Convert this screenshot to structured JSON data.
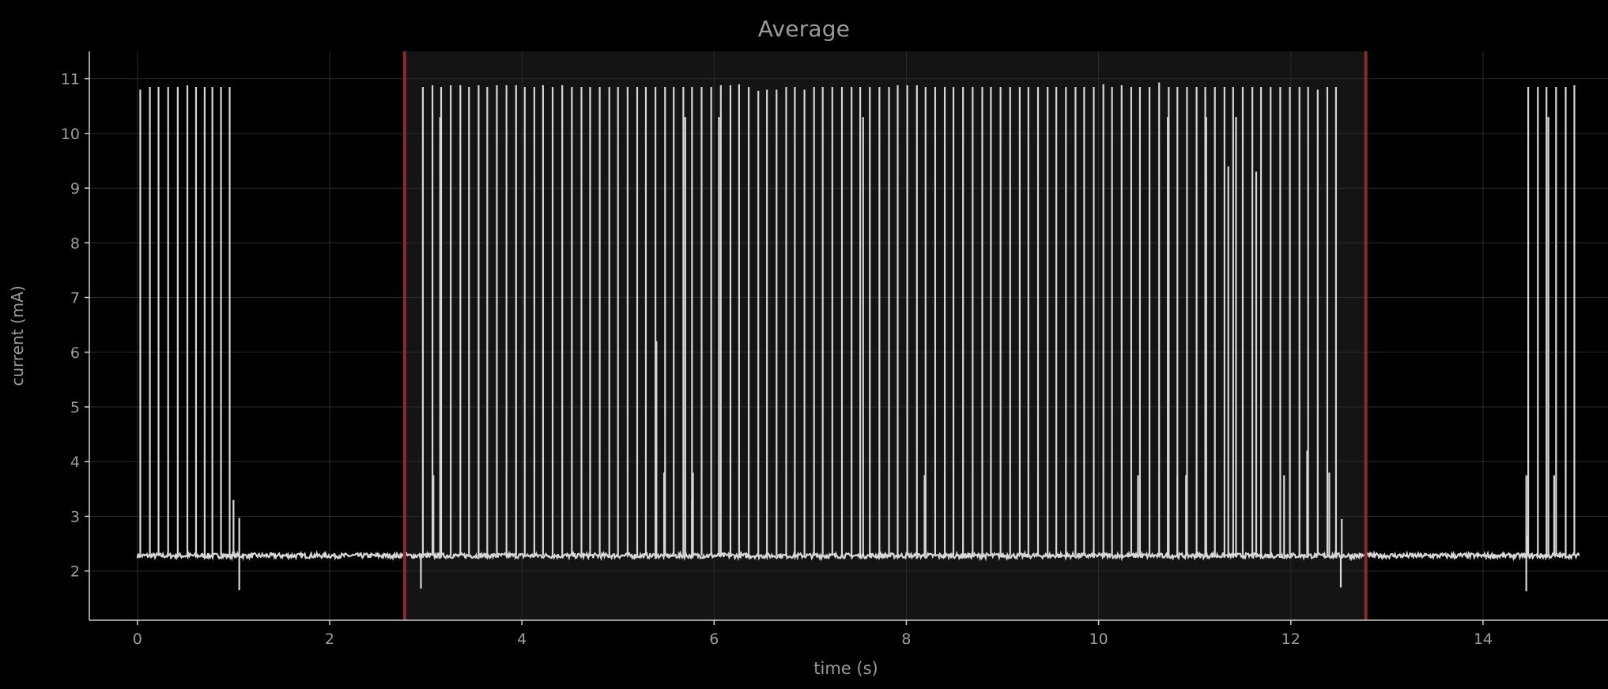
{
  "chart_data": {
    "type": "line",
    "title": "Average",
    "xlabel": "time (s)",
    "ylabel": "current (mA)",
    "xlim": [
      -0.5,
      15.3
    ],
    "ylim": [
      1.1,
      11.5
    ],
    "x_ticks": [
      0,
      2,
      4,
      6,
      8,
      10,
      12,
      14
    ],
    "y_ticks": [
      2,
      3,
      4,
      5,
      6,
      7,
      8,
      9,
      10,
      11
    ],
    "grid": true,
    "baseline_mA": 2.28,
    "time_range": [
      0.0,
      15.0
    ],
    "selection": {
      "start": 2.78,
      "end": 12.78
    },
    "colors": {
      "background": "#000000",
      "selection_fill": "#141414",
      "selection_border": "#8b2a2a",
      "trace": "#d6d6d6",
      "grid": "#2c2c2c",
      "axis": "#cfcfcf",
      "text": "#9d9d9d"
    },
    "series": [
      {
        "spikes": [
          {
            "t": 0.03,
            "peak": 10.8
          },
          {
            "t": 0.13,
            "peak": 10.85
          },
          {
            "t": 0.22,
            "peak": 10.85
          },
          {
            "t": 0.32,
            "peak": 10.85
          },
          {
            "t": 0.42,
            "peak": 10.85
          },
          {
            "t": 0.52,
            "peak": 10.88
          },
          {
            "t": 0.61,
            "peak": 10.85
          },
          {
            "t": 0.7,
            "peak": 10.85
          },
          {
            "t": 0.78,
            "peak": 10.85
          },
          {
            "t": 0.87,
            "peak": 10.85
          },
          {
            "t": 0.96,
            "peak": 10.85
          },
          {
            "t": 1.0,
            "peak": 3.3
          },
          {
            "t": 1.06,
            "peak": 2.97
          },
          {
            "t": 2.97,
            "peak": 10.85
          },
          {
            "t": 3.07,
            "peak": 10.88
          },
          {
            "t": 3.16,
            "peak": 10.85
          },
          {
            "t": 3.26,
            "peak": 10.88
          },
          {
            "t": 3.36,
            "peak": 10.88
          },
          {
            "t": 3.45,
            "peak": 10.85
          },
          {
            "t": 3.55,
            "peak": 10.88
          },
          {
            "t": 3.64,
            "peak": 10.85
          },
          {
            "t": 3.74,
            "peak": 10.88
          },
          {
            "t": 3.84,
            "peak": 10.88
          },
          {
            "t": 3.94,
            "peak": 10.88
          },
          {
            "t": 4.03,
            "peak": 10.85
          },
          {
            "t": 4.13,
            "peak": 10.85
          },
          {
            "t": 4.22,
            "peak": 10.88
          },
          {
            "t": 4.32,
            "peak": 10.85
          },
          {
            "t": 4.42,
            "peak": 10.88
          },
          {
            "t": 4.52,
            "peak": 10.85
          },
          {
            "t": 4.62,
            "peak": 10.85
          },
          {
            "t": 4.71,
            "peak": 10.85
          },
          {
            "t": 4.81,
            "peak": 10.85
          },
          {
            "t": 4.91,
            "peak": 10.85
          },
          {
            "t": 5.0,
            "peak": 10.85
          },
          {
            "t": 5.1,
            "peak": 10.85
          },
          {
            "t": 5.2,
            "peak": 10.85
          },
          {
            "t": 5.29,
            "peak": 10.85
          },
          {
            "t": 5.39,
            "peak": 10.85
          },
          {
            "t": 5.49,
            "peak": 10.85
          },
          {
            "t": 5.58,
            "peak": 10.85
          },
          {
            "t": 5.68,
            "peak": 10.85
          },
          {
            "t": 5.77,
            "peak": 10.85
          },
          {
            "t": 5.87,
            "peak": 10.85
          },
          {
            "t": 5.97,
            "peak": 10.85
          },
          {
            "t": 6.07,
            "peak": 10.88
          },
          {
            "t": 6.17,
            "peak": 10.88
          },
          {
            "t": 6.26,
            "peak": 10.9
          },
          {
            "t": 6.36,
            "peak": 10.85
          },
          {
            "t": 6.46,
            "peak": 10.78
          },
          {
            "t": 6.55,
            "peak": 10.8
          },
          {
            "t": 6.65,
            "peak": 10.8
          },
          {
            "t": 6.75,
            "peak": 10.85
          },
          {
            "t": 6.84,
            "peak": 10.85
          },
          {
            "t": 6.94,
            "peak": 10.8
          },
          {
            "t": 7.04,
            "peak": 10.85
          },
          {
            "t": 7.13,
            "peak": 10.85
          },
          {
            "t": 7.23,
            "peak": 10.85
          },
          {
            "t": 7.33,
            "peak": 10.85
          },
          {
            "t": 7.43,
            "peak": 10.85
          },
          {
            "t": 7.52,
            "peak": 10.85
          },
          {
            "t": 7.62,
            "peak": 10.85
          },
          {
            "t": 7.72,
            "peak": 10.85
          },
          {
            "t": 7.82,
            "peak": 10.85
          },
          {
            "t": 7.91,
            "peak": 10.88
          },
          {
            "t": 8.01,
            "peak": 10.88
          },
          {
            "t": 8.11,
            "peak": 10.88
          },
          {
            "t": 8.2,
            "peak": 10.85
          },
          {
            "t": 8.3,
            "peak": 10.85
          },
          {
            "t": 8.4,
            "peak": 10.85
          },
          {
            "t": 8.49,
            "peak": 10.85
          },
          {
            "t": 8.59,
            "peak": 10.85
          },
          {
            "t": 8.69,
            "peak": 10.85
          },
          {
            "t": 8.79,
            "peak": 10.85
          },
          {
            "t": 8.88,
            "peak": 10.85
          },
          {
            "t": 8.98,
            "peak": 10.85
          },
          {
            "t": 9.08,
            "peak": 10.85
          },
          {
            "t": 9.18,
            "peak": 10.85
          },
          {
            "t": 9.27,
            "peak": 10.85
          },
          {
            "t": 9.37,
            "peak": 10.85
          },
          {
            "t": 9.47,
            "peak": 10.85
          },
          {
            "t": 9.56,
            "peak": 10.85
          },
          {
            "t": 9.66,
            "peak": 10.85
          },
          {
            "t": 9.76,
            "peak": 10.85
          },
          {
            "t": 9.85,
            "peak": 10.85
          },
          {
            "t": 9.95,
            "peak": 10.85
          },
          {
            "t": 10.05,
            "peak": 10.9
          },
          {
            "t": 10.14,
            "peak": 10.85
          },
          {
            "t": 10.24,
            "peak": 10.88
          },
          {
            "t": 10.34,
            "peak": 10.85
          },
          {
            "t": 10.43,
            "peak": 10.85
          },
          {
            "t": 10.53,
            "peak": 10.85
          },
          {
            "t": 10.63,
            "peak": 10.93
          },
          {
            "t": 10.73,
            "peak": 10.85
          },
          {
            "t": 10.82,
            "peak": 10.85
          },
          {
            "t": 10.92,
            "peak": 10.85
          },
          {
            "t": 11.02,
            "peak": 10.85
          },
          {
            "t": 11.11,
            "peak": 10.85
          },
          {
            "t": 11.21,
            "peak": 10.85
          },
          {
            "t": 11.31,
            "peak": 10.85
          },
          {
            "t": 11.4,
            "peak": 10.85
          },
          {
            "t": 11.5,
            "peak": 10.85
          },
          {
            "t": 11.6,
            "peak": 10.85
          },
          {
            "t": 11.69,
            "peak": 10.85
          },
          {
            "t": 11.79,
            "peak": 10.85
          },
          {
            "t": 11.89,
            "peak": 10.85
          },
          {
            "t": 11.99,
            "peak": 10.85
          },
          {
            "t": 12.09,
            "peak": 10.85
          },
          {
            "t": 12.18,
            "peak": 10.85
          },
          {
            "t": 12.28,
            "peak": 10.8
          },
          {
            "t": 12.38,
            "peak": 10.85
          },
          {
            "t": 12.47,
            "peak": 10.85
          },
          {
            "t": 3.15,
            "peak": 10.3
          },
          {
            "t": 5.7,
            "peak": 10.3
          },
          {
            "t": 6.05,
            "peak": 10.3
          },
          {
            "t": 7.55,
            "peak": 10.3
          },
          {
            "t": 10.72,
            "peak": 10.3
          },
          {
            "t": 11.12,
            "peak": 10.3
          },
          {
            "t": 11.43,
            "peak": 10.3
          },
          {
            "t": 11.35,
            "peak": 9.4
          },
          {
            "t": 11.64,
            "peak": 9.3
          },
          {
            "t": 5.4,
            "peak": 6.2
          },
          {
            "t": 3.08,
            "peak": 3.75
          },
          {
            "t": 5.48,
            "peak": 3.8
          },
          {
            "t": 5.78,
            "peak": 3.8
          },
          {
            "t": 5.77,
            "peak": 3.3
          },
          {
            "t": 8.19,
            "peak": 3.75
          },
          {
            "t": 10.41,
            "peak": 3.75
          },
          {
            "t": 10.82,
            "peak": 3.75
          },
          {
            "t": 10.91,
            "peak": 3.75
          },
          {
            "t": 11.93,
            "peak": 3.75
          },
          {
            "t": 12.17,
            "peak": 4.2
          },
          {
            "t": 12.4,
            "peak": 3.8
          },
          {
            "t": 12.53,
            "peak": 2.95
          },
          {
            "t": 14.45,
            "peak": 3.75
          },
          {
            "t": 14.46,
            "peak": 2.65
          },
          {
            "t": 14.47,
            "peak": 10.85
          },
          {
            "t": 14.57,
            "peak": 10.85
          },
          {
            "t": 14.66,
            "peak": 10.85
          },
          {
            "t": 14.68,
            "peak": 10.3
          },
          {
            "t": 14.74,
            "peak": 3.75
          },
          {
            "t": 14.76,
            "peak": 10.85
          },
          {
            "t": 14.86,
            "peak": 10.85
          },
          {
            "t": 14.95,
            "peak": 10.88
          }
        ],
        "dips": [
          {
            "t": 1.06,
            "low": 1.65
          },
          {
            "t": 2.95,
            "low": 1.68
          },
          {
            "t": 12.52,
            "low": 1.7
          },
          {
            "t": 14.45,
            "low": 1.63
          }
        ]
      }
    ]
  }
}
